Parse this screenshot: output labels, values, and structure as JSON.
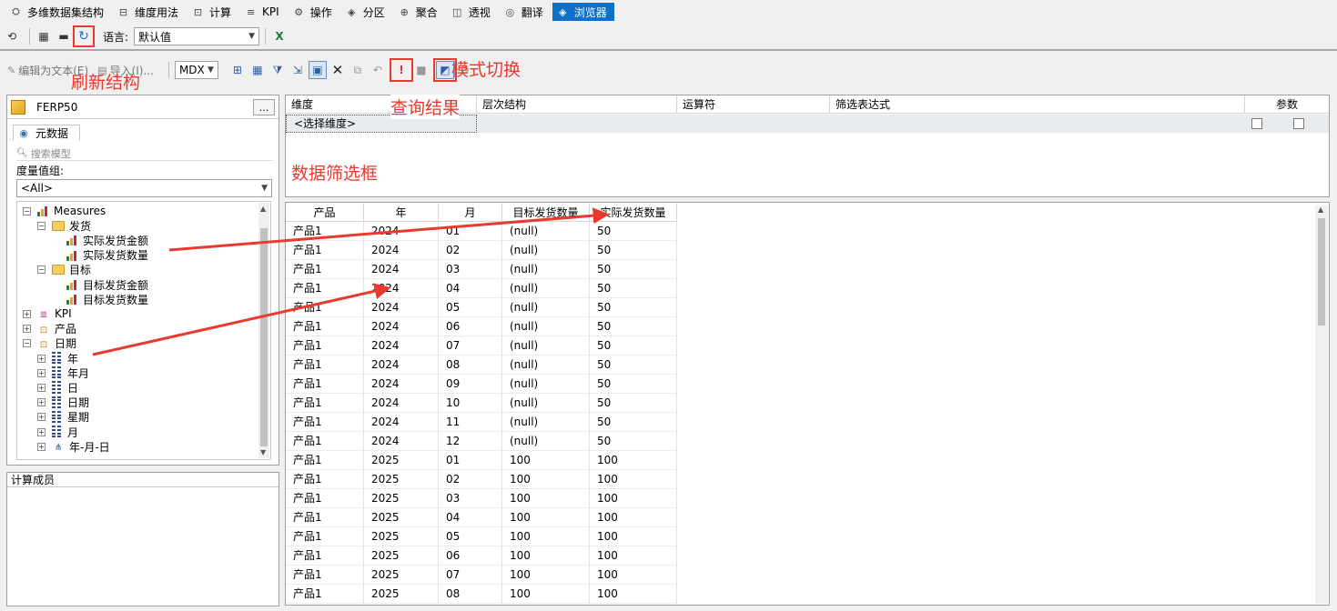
{
  "tabs": [
    {
      "label": "多维数据集结构",
      "icon": "cube-structure-icon"
    },
    {
      "label": "维度用法",
      "icon": "dimension-usage-icon"
    },
    {
      "label": "计算",
      "icon": "calculation-icon"
    },
    {
      "label": "KPI",
      "icon": "kpi-icon"
    },
    {
      "label": "操作",
      "icon": "actions-icon"
    },
    {
      "label": "分区",
      "icon": "partitions-icon"
    },
    {
      "label": "聚合",
      "icon": "aggregations-icon"
    },
    {
      "label": "透视",
      "icon": "perspectives-icon"
    },
    {
      "label": "翻译",
      "icon": "translations-icon"
    },
    {
      "label": "浏览器",
      "icon": "browser-icon",
      "active": true
    }
  ],
  "toolbar2": {
    "language_label": "语言:",
    "language_value": "默认值"
  },
  "toolbar3": {
    "edit_as_text": "编辑为文本(E)",
    "import": "导入(I)...",
    "query_lang": "MDX"
  },
  "annotations": {
    "refresh": "刷新结构",
    "mode_switch": "模式切换",
    "query_result": "查询结果",
    "filter_box": "数据筛选框"
  },
  "left": {
    "cube_name": "FERP50",
    "dots": "...",
    "metadata_tab": "元数据",
    "search_placeholder": "搜索模型",
    "measure_group_label": "度量值组:",
    "measure_group_value": "<All>",
    "calc_members": "计算成员"
  },
  "tree": [
    {
      "label": "Measures",
      "level": 0,
      "pm": "−",
      "icon": "measures"
    },
    {
      "label": "发货",
      "level": 1,
      "pm": "−",
      "icon": "folder"
    },
    {
      "label": "实际发货金额",
      "level": 2,
      "icon": "measure"
    },
    {
      "label": "实际发货数量",
      "level": 2,
      "icon": "measure"
    },
    {
      "label": "目标",
      "level": 1,
      "pm": "−",
      "icon": "folder"
    },
    {
      "label": "目标发货金额",
      "level": 2,
      "icon": "measure"
    },
    {
      "label": "目标发货数量",
      "level": 2,
      "icon": "measure"
    },
    {
      "label": "KPI",
      "level": 0,
      "pm": "+",
      "icon": "kpi"
    },
    {
      "label": "产品",
      "level": 0,
      "pm": "+",
      "icon": "dimension"
    },
    {
      "label": "日期",
      "level": 0,
      "pm": "−",
      "icon": "dimension"
    },
    {
      "label": "年",
      "level": 1,
      "pm": "+",
      "icon": "attribute"
    },
    {
      "label": "年月",
      "level": 1,
      "pm": "+",
      "icon": "attribute"
    },
    {
      "label": "日",
      "level": 1,
      "pm": "+",
      "icon": "attribute"
    },
    {
      "label": "日期",
      "level": 1,
      "pm": "+",
      "icon": "attribute"
    },
    {
      "label": "星期",
      "level": 1,
      "pm": "+",
      "icon": "attribute"
    },
    {
      "label": "月",
      "level": 1,
      "pm": "+",
      "icon": "attribute"
    },
    {
      "label": "年-月-日",
      "level": 1,
      "pm": "+",
      "icon": "hierarchy"
    }
  ],
  "filter": {
    "headers": [
      "维度",
      "层次结构",
      "运算符",
      "筛选表达式",
      "参数"
    ],
    "select_dimension": "<选择维度>"
  },
  "results": {
    "headers": [
      "产品",
      "年",
      "月",
      "目标发货数量",
      "实际发货数量"
    ],
    "rows": [
      [
        "产品1",
        "2024",
        "01",
        "(null)",
        "50"
      ],
      [
        "产品1",
        "2024",
        "02",
        "(null)",
        "50"
      ],
      [
        "产品1",
        "2024",
        "03",
        "(null)",
        "50"
      ],
      [
        "产品1",
        "2024",
        "04",
        "(null)",
        "50"
      ],
      [
        "产品1",
        "2024",
        "05",
        "(null)",
        "50"
      ],
      [
        "产品1",
        "2024",
        "06",
        "(null)",
        "50"
      ],
      [
        "产品1",
        "2024",
        "07",
        "(null)",
        "50"
      ],
      [
        "产品1",
        "2024",
        "08",
        "(null)",
        "50"
      ],
      [
        "产品1",
        "2024",
        "09",
        "(null)",
        "50"
      ],
      [
        "产品1",
        "2024",
        "10",
        "(null)",
        "50"
      ],
      [
        "产品1",
        "2024",
        "11",
        "(null)",
        "50"
      ],
      [
        "产品1",
        "2024",
        "12",
        "(null)",
        "50"
      ],
      [
        "产品1",
        "2025",
        "01",
        "100",
        "100"
      ],
      [
        "产品1",
        "2025",
        "02",
        "100",
        "100"
      ],
      [
        "产品1",
        "2025",
        "03",
        "100",
        "100"
      ],
      [
        "产品1",
        "2025",
        "04",
        "100",
        "100"
      ],
      [
        "产品1",
        "2025",
        "05",
        "100",
        "100"
      ],
      [
        "产品1",
        "2025",
        "06",
        "100",
        "100"
      ],
      [
        "产品1",
        "2025",
        "07",
        "100",
        "100"
      ],
      [
        "产品1",
        "2025",
        "08",
        "100",
        "100"
      ]
    ]
  },
  "colors": {
    "accent": "#0e71c9",
    "annotation": "#e83a2f"
  }
}
